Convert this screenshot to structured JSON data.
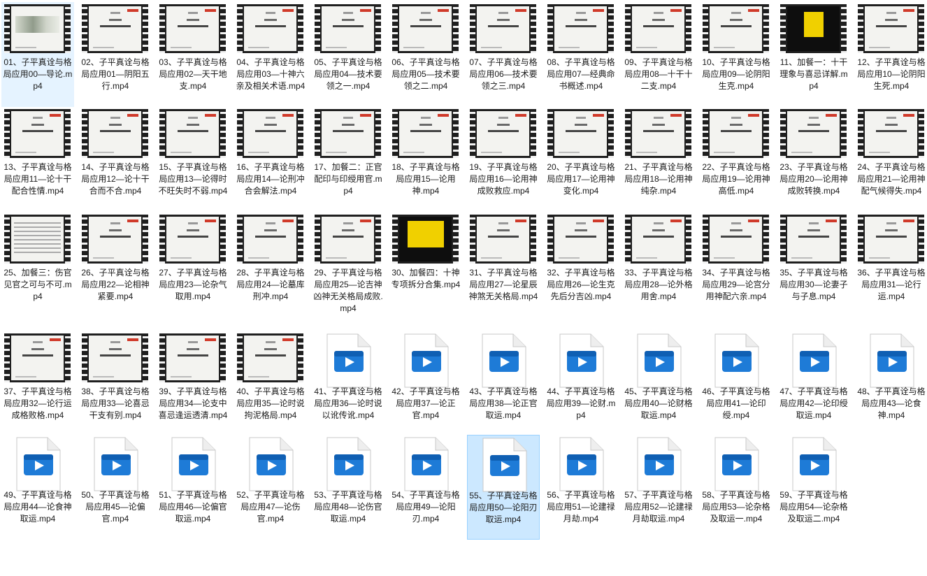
{
  "files": [
    {
      "name": "01、子平真诠与格局应用00—导论.mp4",
      "thumb": "brush",
      "state": "hovered"
    },
    {
      "name": "02、子平真诠与格局应用01—阴阳五行.mp4",
      "thumb": "slide"
    },
    {
      "name": "03、子平真诠与格局应用02—天干地支.mp4",
      "thumb": "slide"
    },
    {
      "name": "04、子平真诠与格局应用03—十神六亲及相关术语.mp4",
      "thumb": "slide"
    },
    {
      "name": "05、子平真诠与格局应用04—技术要领之一.mp4",
      "thumb": "slide"
    },
    {
      "name": "06、子平真诠与格局应用05—技术要领之二.mp4",
      "thumb": "slide"
    },
    {
      "name": "07、子平真诠与格局应用06—技术要领之三.mp4",
      "thumb": "slide"
    },
    {
      "name": "08、子平真诠与格局应用07—经典命书概述.mp4",
      "thumb": "slide"
    },
    {
      "name": "09、子平真诠与格局应用08—十干十二支.mp4",
      "thumb": "slide"
    },
    {
      "name": "10、子平真诠与格局应用09—论阴阳生克.mp4",
      "thumb": "slide"
    },
    {
      "name": "11、加餐一：十干理象与喜忌详解.mp4",
      "thumb": "dark"
    },
    {
      "name": "12、子平真诠与格局应用10—论阴阳生死.mp4",
      "thumb": "slide"
    },
    {
      "name": "13、子平真诠与格局应用11—论十干配合性情.mp4",
      "thumb": "slide"
    },
    {
      "name": "14、子平真诠与格局应用12—论十干合而不合.mp4",
      "thumb": "slide"
    },
    {
      "name": "15、子平真诠与格局应用13—论得时不旺失时不弱.mp4",
      "thumb": "slide"
    },
    {
      "name": "16、子平真诠与格局应用14—论刑冲合会解法.mp4",
      "thumb": "slide"
    },
    {
      "name": "17、加餐二：正官配印与印绶用官.mp4",
      "thumb": "slide"
    },
    {
      "name": "18、子平真诠与格局应用15—论用神.mp4",
      "thumb": "slide"
    },
    {
      "name": "19、子平真诠与格局应用16—论用神成败救应.mp4",
      "thumb": "slide"
    },
    {
      "name": "20、子平真诠与格局应用17—论用神变化.mp4",
      "thumb": "slide"
    },
    {
      "name": "21、子平真诠与格局应用18—论用神纯杂.mp4",
      "thumb": "slide"
    },
    {
      "name": "22、子平真诠与格局应用19—论用神高低.mp4",
      "thumb": "slide"
    },
    {
      "name": "23、子平真诠与格局应用20—论用神成败转换.mp4",
      "thumb": "slide"
    },
    {
      "name": "24、子平真诠与格局应用21—论用神配气候得失.mp4",
      "thumb": "slide"
    },
    {
      "name": "25、加餐三：伤官见官之可与不可.mp4",
      "thumb": "list"
    },
    {
      "name": "26、子平真诠与格局应用22—论相神紧要.mp4",
      "thumb": "slide"
    },
    {
      "name": "27、子平真诠与格局应用23—论杂气取用.mp4",
      "thumb": "slide"
    },
    {
      "name": "28、子平真诠与格局应用24—论墓库刑冲.mp4",
      "thumb": "slide"
    },
    {
      "name": "29、子平真诠与格局应用25—论吉神凶神无关格局成败.mp4",
      "thumb": "slide"
    },
    {
      "name": "30、加餐四：十神专项拆分合集.mp4",
      "thumb": "yellow"
    },
    {
      "name": "31、子平真诠与格局应用27—论星辰神煞无关格局.mp4",
      "thumb": "slide"
    },
    {
      "name": "32、子平真诠与格局应用26—论生克先后分吉凶.mp4",
      "thumb": "slide"
    },
    {
      "name": "33、子平真诠与格局应用28—论外格用舍.mp4",
      "thumb": "slide"
    },
    {
      "name": "34、子平真诠与格局应用29—论宫分用神配六亲.mp4",
      "thumb": "slide"
    },
    {
      "name": "35、子平真诠与格局应用30—论妻子与子息.mp4",
      "thumb": "slide"
    },
    {
      "name": "36、子平真诠与格局应用31—论行运.mp4",
      "thumb": "slide"
    },
    {
      "name": "37、子平真诠与格局应用32—论行运成格败格.mp4",
      "thumb": "slide"
    },
    {
      "name": "38、子平真诠与格局应用33—论喜忌干支有别.mp4",
      "thumb": "slide"
    },
    {
      "name": "39、子平真诠与格局应用34—论支中喜忌逢运透清.mp4",
      "thumb": "slide"
    },
    {
      "name": "40、子平真诠与格局应用35—论时说拘泥格局.mp4",
      "thumb": "slide"
    },
    {
      "name": "41、子平真诠与格局应用36—论时说以讹传讹.mp4",
      "thumb": "icon"
    },
    {
      "name": "42、子平真诠与格局应用37—论正官.mp4",
      "thumb": "icon"
    },
    {
      "name": "43、子平真诠与格局应用38—论正官取运.mp4",
      "thumb": "icon"
    },
    {
      "name": "44、子平真诠与格局应用39—论财.mp4",
      "thumb": "icon"
    },
    {
      "name": "45、子平真诠与格局应用40—论财格取运.mp4",
      "thumb": "icon"
    },
    {
      "name": "46、子平真诠与格局应用41—论印绶.mp4",
      "thumb": "icon"
    },
    {
      "name": "47、子平真诠与格局应用42—论印绶取运.mp4",
      "thumb": "icon"
    },
    {
      "name": "48、子平真诠与格局应用43—论食神.mp4",
      "thumb": "icon"
    },
    {
      "name": "49、子平真诠与格局应用44—论食神取运.mp4",
      "thumb": "icon"
    },
    {
      "name": "50、子平真诠与格局应用45—论偏官.mp4",
      "thumb": "icon"
    },
    {
      "name": "51、子平真诠与格局应用46—论偏官取运.mp4",
      "thumb": "icon"
    },
    {
      "name": "52、子平真诠与格局应用47—论伤官.mp4",
      "thumb": "icon"
    },
    {
      "name": "53、子平真诠与格局应用48—论伤官取运.mp4",
      "thumb": "icon"
    },
    {
      "name": "54、子平真诠与格局应用49—论阳刃.mp4",
      "thumb": "icon"
    },
    {
      "name": "55、子平真诠与格局应用50—论阳刃取运.mp4",
      "thumb": "icon",
      "state": "selected"
    },
    {
      "name": "56、子平真诠与格局应用51—论建禄月劫.mp4",
      "thumb": "icon"
    },
    {
      "name": "57、子平真诠与格局应用52—论建禄月劫取运.mp4",
      "thumb": "icon"
    },
    {
      "name": "58、子平真诠与格局应用53—论杂格及取运一.mp4",
      "thumb": "icon"
    },
    {
      "name": "59、子平真诠与格局应用54—论杂格及取运二.mp4",
      "thumb": "icon"
    }
  ],
  "colors": {
    "icon_blue": "#1e7bd7",
    "icon_blue_dark": "#0f5fb3",
    "selection": "#cce8ff",
    "hover": "#e5f3ff"
  }
}
